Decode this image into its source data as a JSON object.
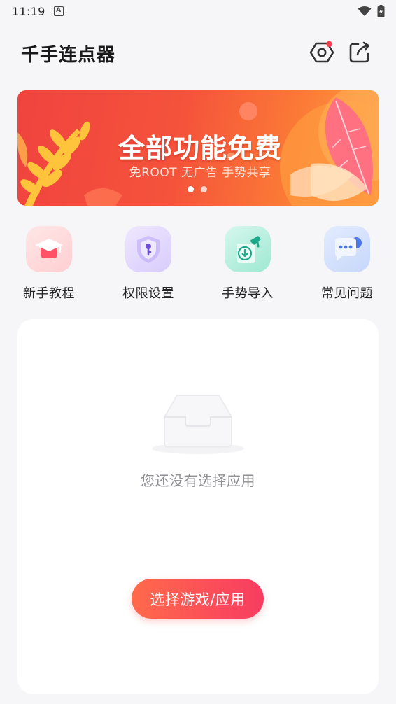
{
  "status_bar": {
    "time": "11:19",
    "notification_glyph": "A"
  },
  "header": {
    "title": "千手连点器"
  },
  "banner": {
    "headline": "全部功能免费",
    "subtitle": "免ROOT  无广告  手势共享",
    "pages": 2,
    "active_page": 1
  },
  "quick_actions": [
    {
      "label": "新手教程",
      "icon": "graduation-cap-icon"
    },
    {
      "label": "权限设置",
      "icon": "shield-key-icon"
    },
    {
      "label": "手势导入",
      "icon": "gesture-import-icon"
    },
    {
      "label": "常见问题",
      "icon": "chat-bubble-icon"
    }
  ],
  "main": {
    "empty_text": "您还没有选择应用",
    "select_button_label": "选择游戏/应用"
  },
  "colors": {
    "accent_start": "#ff6a4b",
    "accent_end": "#f83c61",
    "background": "#f6f6f9",
    "card": "#ffffff"
  }
}
